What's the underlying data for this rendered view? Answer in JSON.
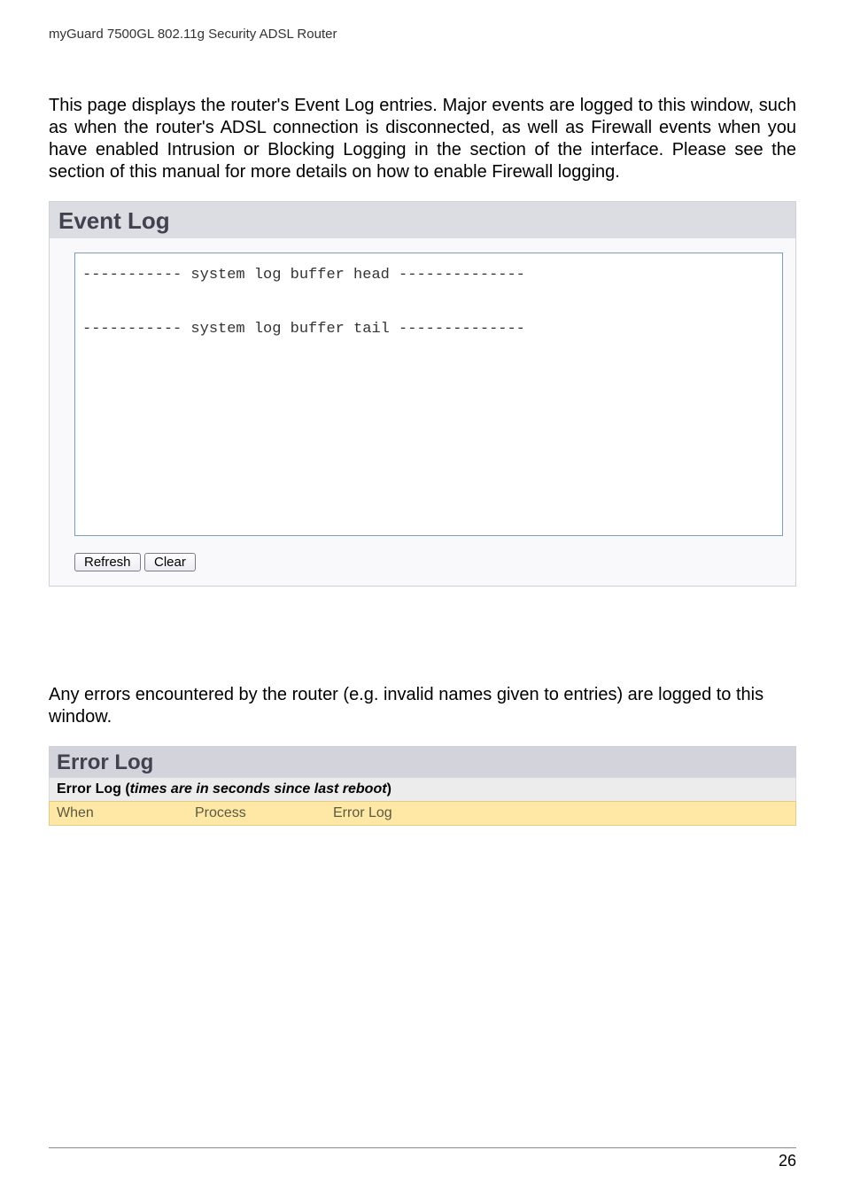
{
  "doc_header": "myGuard 7500GL 802.11g Security ADSL Router",
  "intro_paragraph": "This page displays the router's Event Log entries. Major events are logged to this window, such as when the router's ADSL connection is disconnected, as well as Firewall events when you have enabled Intrusion or Blocking Logging in the                                     section of the interface. Please see the               section of this manual for more details on how to enable Firewall logging.",
  "event_log": {
    "title": "Event Log",
    "content": "----------- system log buffer head --------------\n\n----------- system log buffer tail --------------",
    "buttons": {
      "refresh": "Refresh",
      "clear": "Clear"
    }
  },
  "mid_paragraph": "Any errors encountered by the router (e.g. invalid names given to entries) are logged to this window.",
  "error_log": {
    "title": "Error Log",
    "subtitle_prefix": "Error Log (",
    "subtitle_italic": "times are in seconds since last reboot",
    "subtitle_suffix": ")",
    "columns": {
      "when": "When",
      "process": "Process",
      "error": "Error Log"
    }
  },
  "page_number": "26"
}
